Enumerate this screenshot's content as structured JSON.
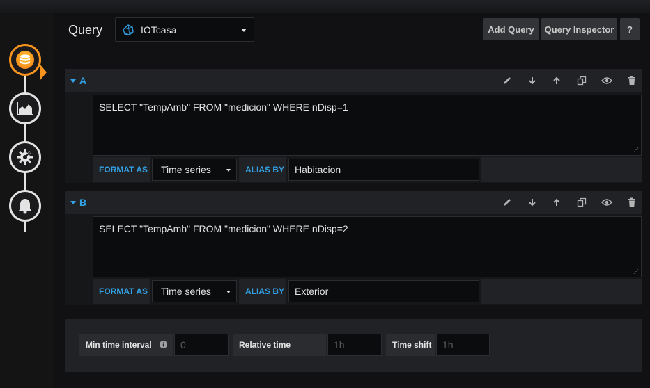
{
  "header": {
    "title": "Query",
    "datasource": {
      "name": "IOTcasa",
      "icon": "influxdb-icon"
    },
    "buttons": {
      "add_query": "Add Query",
      "query_inspector": "Query Inspector",
      "help": "?"
    }
  },
  "sidebar": {
    "items": [
      {
        "name": "queries",
        "icon": "database-icon",
        "active": true
      },
      {
        "name": "visualization",
        "icon": "area-chart-icon",
        "active": false
      },
      {
        "name": "general",
        "icon": "gear-icon",
        "active": false
      },
      {
        "name": "alert",
        "icon": "bell-icon",
        "active": false
      }
    ]
  },
  "queries": [
    {
      "ref_id": "A",
      "query": "SELECT \"TempAmb\" FROM \"medicion\" WHERE nDisp=1",
      "format_as_label": "FORMAT AS",
      "format_as_value": "Time series",
      "alias_by_label": "ALIAS BY",
      "alias_by_value": "Habitacion"
    },
    {
      "ref_id": "B",
      "query": "SELECT \"TempAmb\" FROM \"medicion\" WHERE nDisp=2",
      "format_as_label": "FORMAT AS",
      "format_as_value": "Time series",
      "alias_by_label": "ALIAS BY",
      "alias_by_value": "Exterior"
    }
  ],
  "options": {
    "min_interval_label": "Min time interval",
    "min_interval_placeholder": "0",
    "relative_time_label": "Relative time",
    "relative_time_placeholder": "1h",
    "time_shift_label": "Time shift",
    "time_shift_placeholder": "1h"
  },
  "colors": {
    "accent": "#33a2e5",
    "active": "#f7941e"
  }
}
